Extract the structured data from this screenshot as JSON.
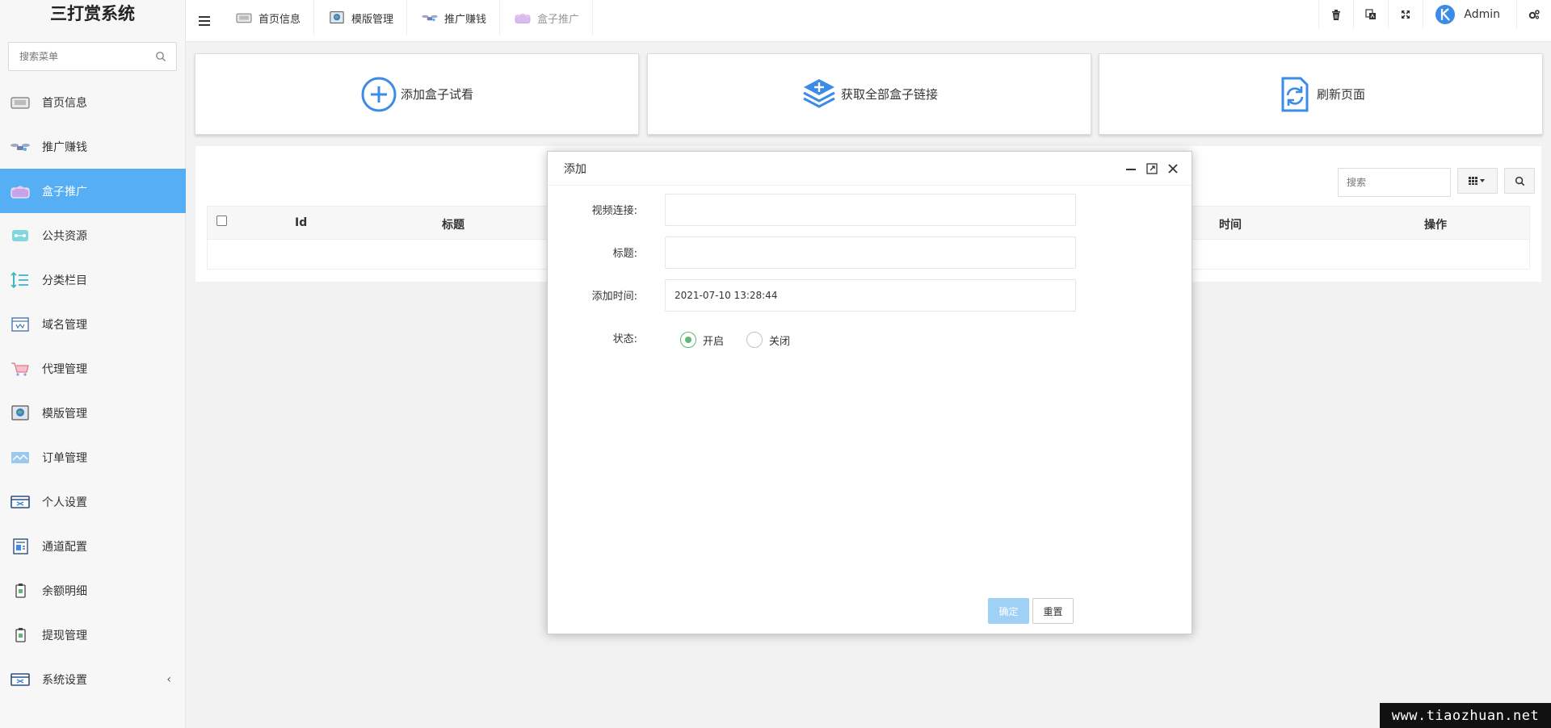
{
  "app": {
    "title": "三打赏系统"
  },
  "menu_search": {
    "placeholder": "搜索菜单"
  },
  "sidebar": {
    "items": [
      {
        "label": "首页信息",
        "icon": "home-tray-icon",
        "active": false
      },
      {
        "label": "推广赚钱",
        "icon": "drone-icon",
        "active": false
      },
      {
        "label": "盒子推广",
        "icon": "box-icon",
        "active": true
      },
      {
        "label": "公共资源",
        "icon": "network-icon",
        "active": false
      },
      {
        "label": "分类栏目",
        "icon": "sort-list-icon",
        "active": false
      },
      {
        "label": "域名管理",
        "icon": "web-window-icon",
        "active": false
      },
      {
        "label": "代理管理",
        "icon": "cart-icon",
        "active": false
      },
      {
        "label": "模版管理",
        "icon": "globe-monitor-icon",
        "active": false
      },
      {
        "label": "订单管理",
        "icon": "map-card-icon",
        "active": false
      },
      {
        "label": "个人设置",
        "icon": "id-card-icon",
        "active": false
      },
      {
        "label": "通道配置",
        "icon": "config-doc-icon",
        "active": false
      },
      {
        "label": "余额明细",
        "icon": "clipboard-icon",
        "active": false
      },
      {
        "label": "提现管理",
        "icon": "clipboard-icon",
        "active": false
      },
      {
        "label": "系统设置",
        "icon": "system-window-icon",
        "active": false,
        "has_children": true
      }
    ]
  },
  "topbar": {
    "tabs": [
      {
        "label": "首页信息",
        "icon": "home-tray-icon"
      },
      {
        "label": "模版管理",
        "icon": "globe-monitor-icon"
      },
      {
        "label": "推广赚钱",
        "icon": "drone-icon"
      },
      {
        "label": "盒子推广",
        "icon": "box-icon"
      }
    ],
    "user": "Admin"
  },
  "cards": [
    {
      "label": "添加盒子试看",
      "icon": "plus-circle-icon"
    },
    {
      "label": "获取全部盒子链接",
      "icon": "layers-plus-icon"
    },
    {
      "label": "刷新页面",
      "icon": "refresh-doc-icon"
    }
  ],
  "table": {
    "search_placeholder": "搜索",
    "columns": [
      "Id",
      "标题",
      "时间",
      "操作"
    ]
  },
  "modal": {
    "title": "添加",
    "fields": {
      "video_label": "视频连接:",
      "video_value": "",
      "title_label": "标题:",
      "title_value": "",
      "time_label": "添加时间:",
      "time_value": "2021-07-10 13:28:44",
      "status_label": "状态:",
      "status_on": "开启",
      "status_off": "关闭"
    },
    "ok_label": "确定",
    "reset_label": "重置"
  },
  "watermark": "www.tiaozhuan.net",
  "colors": {
    "accent": "#56aef4",
    "radio_on": "#5fb878",
    "ok_button": "#9fd1f7",
    "icon_blue": "#3b8be8"
  }
}
